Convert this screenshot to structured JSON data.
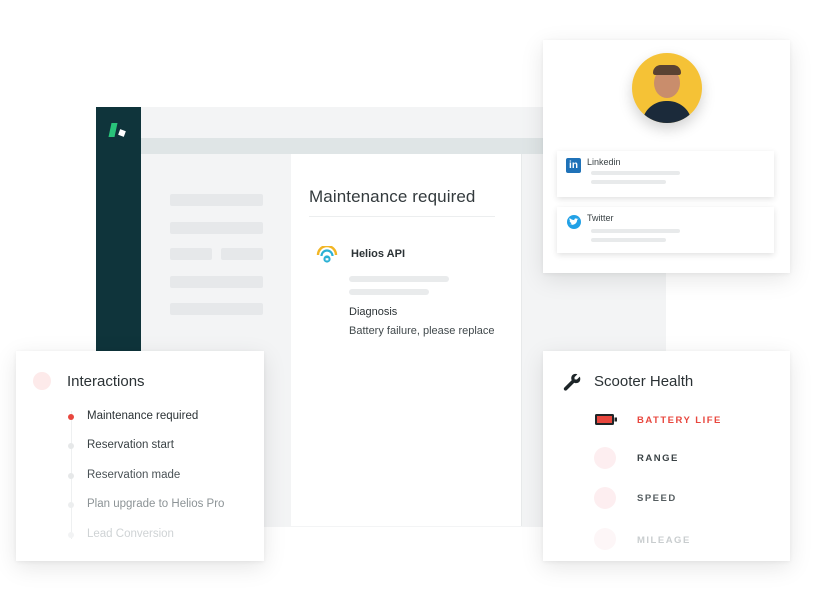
{
  "content": {
    "title": "Maintenance required",
    "api_name": "Helios API",
    "diagnosis_label": "Diagnosis",
    "diagnosis_text": "Battery failure, please replace"
  },
  "profile": {
    "linkedin_label": "Linkedin",
    "twitter_label": "Twitter"
  },
  "interactions": {
    "title": "Interactions",
    "items": [
      {
        "label": "Maintenance required",
        "active": true
      },
      {
        "label": "Reservation start",
        "active": false
      },
      {
        "label": "Reservation made",
        "active": false
      },
      {
        "label": "Plan upgrade to Helios Pro",
        "active": false
      },
      {
        "label": "Lead Conversion",
        "active": false
      }
    ]
  },
  "scooter": {
    "title": "Scooter Health",
    "metrics": [
      {
        "label": "BATTERY LIFE",
        "alert": true
      },
      {
        "label": "RANGE",
        "alert": false
      },
      {
        "label": "SPEED",
        "alert": false
      },
      {
        "label": "MILEAGE",
        "alert": false
      }
    ]
  },
  "colors": {
    "sidebar": "#0f343b",
    "brand_green": "#29c47a",
    "alert_red": "#e8473e",
    "linkedin_blue": "#1f72b8",
    "twitter_blue": "#22a1e6",
    "avatar_bg": "#f5c236"
  },
  "icons": [
    "logo-icon",
    "helios-api-icon",
    "linkedin-icon",
    "twitter-icon",
    "wrench-icon",
    "battery-icon"
  ]
}
